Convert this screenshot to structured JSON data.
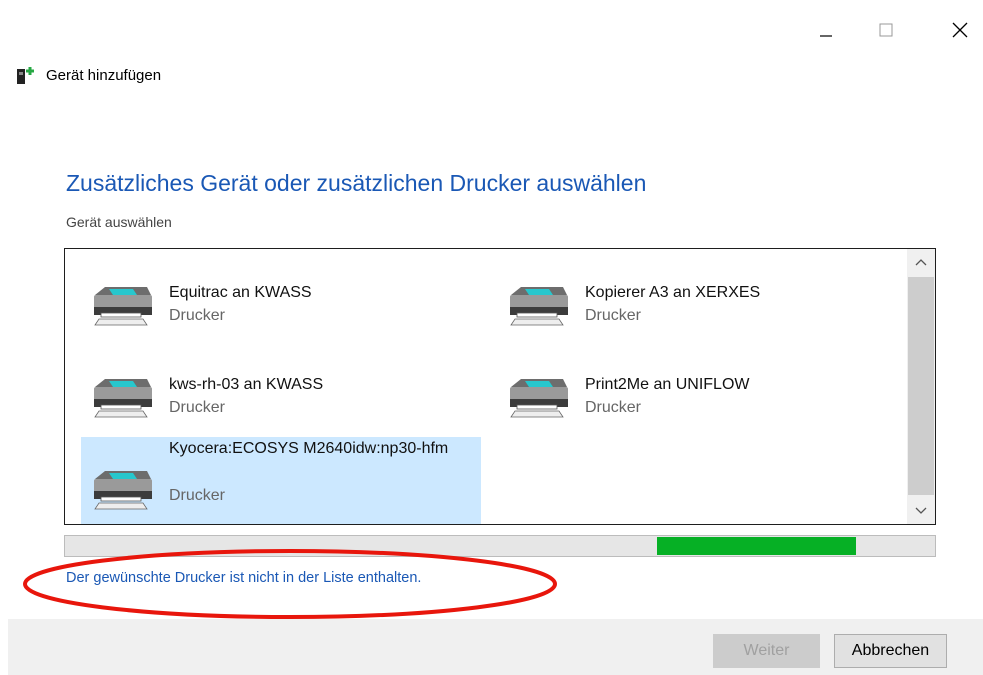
{
  "window": {
    "title": "Gerät hinzufügen",
    "controls": {
      "minimize": "minimize-icon",
      "maximize": "maximize-icon",
      "close": "close-icon"
    }
  },
  "main": {
    "heading": "Zusätzliches Gerät oder zusätzlichen Drucker auswählen",
    "subheading": "Gerät auswählen"
  },
  "devices": [
    {
      "name": "Equitrac an KWASS",
      "type": "Drucker",
      "icon": "printer-icon",
      "selected": false
    },
    {
      "name": "Kopierer A3 an XERXES",
      "type": "Drucker",
      "icon": "printer-icon",
      "selected": false
    },
    {
      "name": "kws-rh-03 an KWASS",
      "type": "Drucker",
      "icon": "printer-icon",
      "selected": false
    },
    {
      "name": "Print2Me an UNIFLOW",
      "type": "Drucker",
      "icon": "printer-icon",
      "selected": false
    },
    {
      "name": "Kyocera:ECOSYS M2640idw:np30-hfm",
      "type": "Drucker",
      "icon": "printer-icon",
      "selected": true
    }
  ],
  "progress": {
    "state": "indeterminate (marquee)"
  },
  "link": "Der gewünschte Drucker ist nicht in der Liste enthalten.",
  "buttons": {
    "next": "Weiter",
    "next_enabled": false,
    "cancel": "Abbrechen"
  },
  "colors": {
    "accent": "#1a58b5",
    "selection": "#cce8ff",
    "progress": "#06b025",
    "annotation": "#e8160c"
  }
}
